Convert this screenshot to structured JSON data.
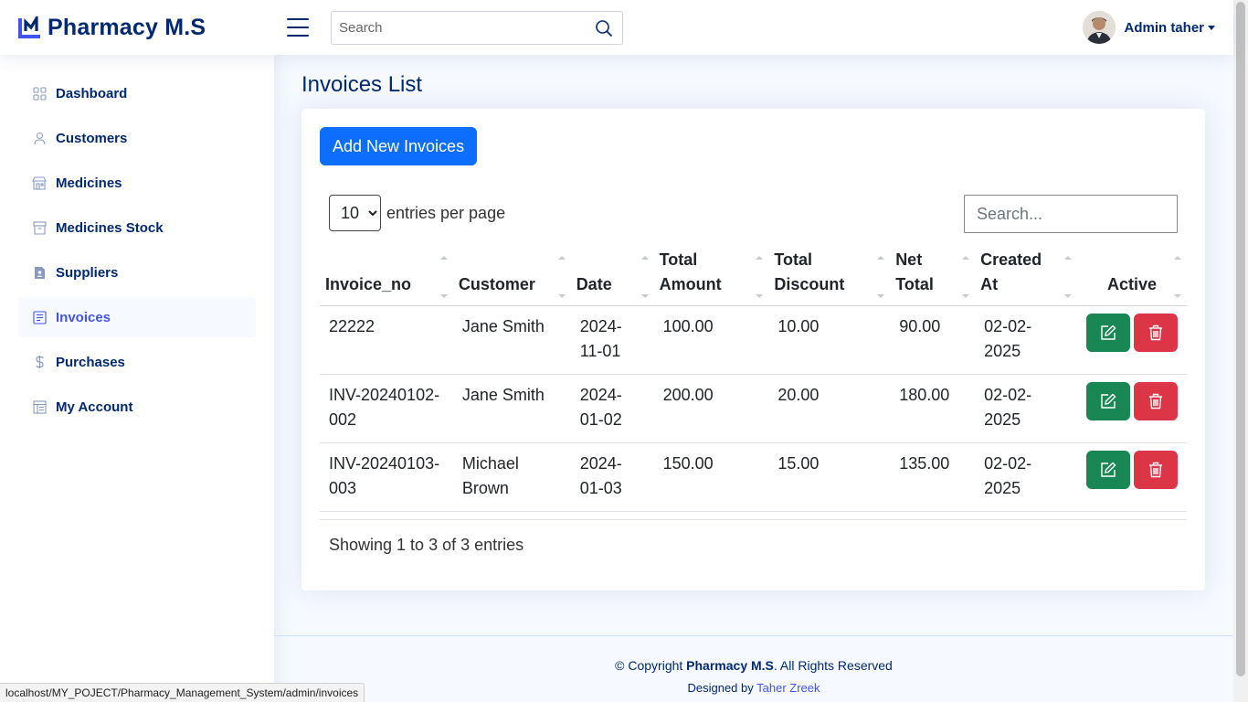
{
  "header": {
    "logo_text": "Pharmacy M.S",
    "search_placeholder": "Search",
    "profile_name": "Admin taher"
  },
  "sidebar": {
    "items": [
      {
        "label": "Dashboard",
        "icon": "grid-icon"
      },
      {
        "label": "Customers",
        "icon": "person-icon"
      },
      {
        "label": "Medicines",
        "icon": "shop-icon"
      },
      {
        "label": "Medicines Stock",
        "icon": "archive-icon"
      },
      {
        "label": "Suppliers",
        "icon": "file-person-icon"
      },
      {
        "label": "Invoices",
        "icon": "receipt-icon",
        "active": true
      },
      {
        "label": "Purchases",
        "icon": "dollar-icon"
      },
      {
        "label": "My Account",
        "icon": "layout-icon"
      }
    ]
  },
  "main": {
    "page_title": "Invoices List",
    "add_button": "Add New Invoices",
    "per_page_value": "10",
    "per_page_label": "entries per page",
    "search_placeholder": "Search...",
    "columns": [
      {
        "line1": "",
        "line2": "Invoice_no"
      },
      {
        "line1": "",
        "line2": "Customer"
      },
      {
        "line1": "",
        "line2": "Date"
      },
      {
        "line1": "Total",
        "line2": "Amount"
      },
      {
        "line1": "Total",
        "line2": "Discount"
      },
      {
        "line1": "Net",
        "line2": "Total"
      },
      {
        "line1": "Created",
        "line2": "At"
      },
      {
        "line1": "",
        "line2": "Active"
      }
    ],
    "rows": [
      {
        "invoice_no": [
          "22222"
        ],
        "customer": [
          "Jane Smith"
        ],
        "date": [
          "2024-",
          "11-01"
        ],
        "total_amount": "100.00",
        "total_discount": "10.00",
        "net_total": "90.00",
        "created_at": [
          "02-02-",
          "2025"
        ]
      },
      {
        "invoice_no": [
          "INV-20240102-",
          "002"
        ],
        "customer": [
          "Jane Smith"
        ],
        "date": [
          "2024-",
          "01-02"
        ],
        "total_amount": "200.00",
        "total_discount": "20.00",
        "net_total": "180.00",
        "created_at": [
          "02-02-",
          "2025"
        ]
      },
      {
        "invoice_no": [
          "INV-20240103-",
          "003"
        ],
        "customer": [
          "Michael",
          "Brown"
        ],
        "date": [
          "2024-",
          "01-03"
        ],
        "total_amount": "150.00",
        "total_discount": "15.00",
        "net_total": "135.00",
        "created_at": [
          "02-02-",
          "2025"
        ]
      }
    ],
    "showing_text": "Showing 1 to 3 of 3 entries"
  },
  "footer": {
    "copyright_prefix": "© Copyright ",
    "copyright_brand": "Pharmacy M.S",
    "copyright_suffix": ". All Rights Reserved",
    "designed_by": "Designed by ",
    "designer": "Taher Zreek"
  },
  "statusbar": {
    "url": "localhost/MY_POJECT/Pharmacy_Management_System/admin/invoices"
  },
  "colors": {
    "brand": "#012970",
    "accent": "#4154f1",
    "primary": "#0d6efd",
    "success": "#198754",
    "danger": "#dc3545"
  }
}
